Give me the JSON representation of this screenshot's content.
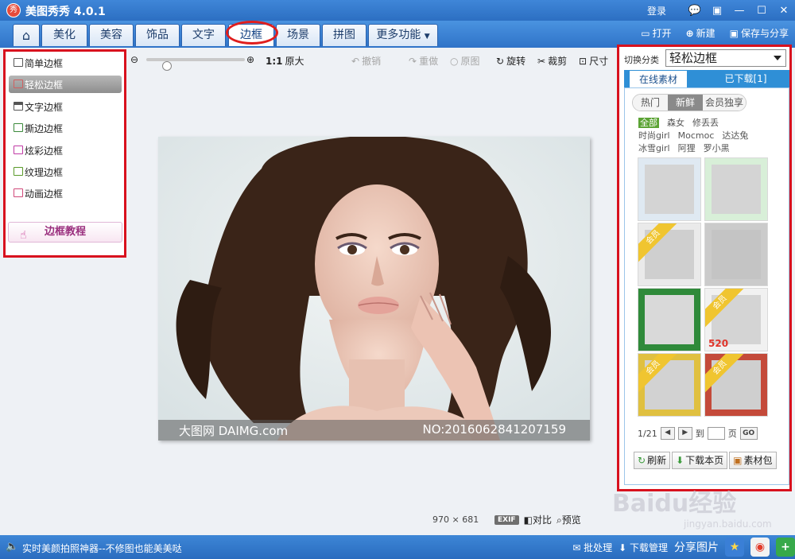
{
  "window": {
    "logo_char": "秀",
    "title": "美图秀秀 4.0.1",
    "login_label": "登录",
    "controls": [
      "☐",
      "▣",
      "—",
      "☐",
      "✕"
    ]
  },
  "nav": {
    "tabs": [
      "美化",
      "美容",
      "饰品",
      "文字",
      "边框",
      "场景",
      "拼图",
      "更多功能"
    ],
    "active_tab": "边框",
    "open_label": "打开",
    "new_label": "新建",
    "save_label": "保存与分享"
  },
  "left_panel": {
    "items": [
      "简单边框",
      "轻松边框",
      "文字边框",
      "撕边边框",
      "炫彩边框",
      "纹理边框",
      "动画边框"
    ],
    "active_item": "轻松边框",
    "tutorial_label": "边框教程"
  },
  "toolbar": {
    "ratio_label": "1:1",
    "original_size_label": "原大",
    "undo_label": "撤销",
    "redo_label": "重做",
    "original_label": "原图",
    "rotate_label": "旋转",
    "crop_label": "裁剪",
    "size_label": "尺寸"
  },
  "canvas": {
    "watermark_left": "大图网 DAIMG.com",
    "watermark_right": "NO:2016062841207159",
    "dimensions_w": "970",
    "dimensions_x": "×",
    "dimensions_h": "681",
    "exif_label": "EXIF",
    "compare_label": "对比",
    "preview_label": "预览"
  },
  "right_panel": {
    "switch_label": "切换分类",
    "category": "轻松边框",
    "tab_online": "在线素材",
    "tab_downloaded": "已下载[1]",
    "sub_tabs": [
      "热门",
      "新鲜",
      "会员独享"
    ],
    "active_sub_tab": "新鲜",
    "filter_all": "全部",
    "filters": [
      "森女",
      "修丢丢",
      "时尚girl",
      "Mocmoc",
      "达达兔",
      "冰雪girl",
      "阿狸",
      "罗小黑"
    ],
    "member_badge": "会员",
    "thumb_text_520": "520",
    "page_indicator": "1/21",
    "goto_label": "到",
    "page_unit": "页",
    "go_label": "GO",
    "refresh_label": "刷新",
    "download_page_label": "下载本页",
    "package_label": "素材包"
  },
  "status": {
    "tip": "实时美颜拍照神器--不修图也能美美哒",
    "batch_label": "批处理",
    "download_manager_label": "下载管理",
    "share_label": "分享图片"
  },
  "watermark": {
    "brand": "Baidu经验",
    "url": "jingyan.baidu.com"
  },
  "colors": {
    "title_blue": "#2c6fc2",
    "highlight_red": "#d8111e",
    "tab_text": "#1d3d6b",
    "member_gold": "#f0c530"
  }
}
